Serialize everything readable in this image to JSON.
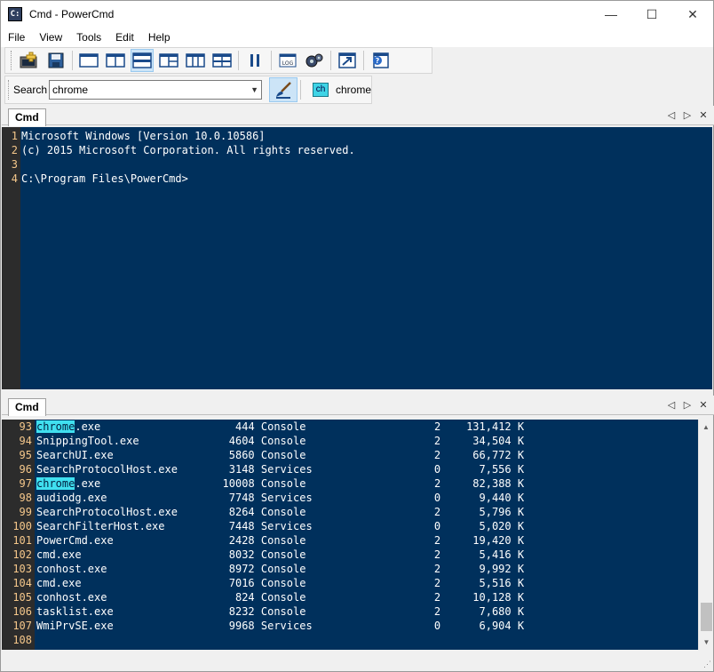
{
  "window": {
    "title": "Cmd - PowerCmd",
    "icon_text": "C:"
  },
  "window_controls": {
    "minimize": "—",
    "maximize": "☐",
    "close": "✕"
  },
  "menu": [
    "File",
    "View",
    "Tools",
    "Edit",
    "Help"
  ],
  "toolbar": {
    "buttons": [
      "new-console",
      "save",
      "layout-single",
      "layout-two-columns",
      "layout-two-rows",
      "layout-three-left",
      "layout-three-columns",
      "layout-four-grid",
      "pause",
      "log-bug",
      "settings-gears",
      "open-external",
      "help"
    ],
    "active_button": "layout-two-rows"
  },
  "search": {
    "label": "Search",
    "value": "chrome",
    "badge": "ch",
    "term": "chrome"
  },
  "pane_top": {
    "tab_label": "Cmd",
    "line_numbers": [
      "1",
      "2",
      "3",
      "4"
    ],
    "lines": [
      "Microsoft Windows [Version 10.0.10586]",
      "(c) 2015 Microsoft Corporation. All rights reserved.",
      "",
      "C:\\Program Files\\PowerCmd>"
    ]
  },
  "pane_bottom": {
    "tab_label": "Cmd",
    "rows": [
      {
        "n": "93",
        "name": "chrome.exe",
        "pid": "444",
        "session": "Console",
        "num": "2",
        "mem": "131,412 K"
      },
      {
        "n": "94",
        "name": "SnippingTool.exe",
        "pid": "4604",
        "session": "Console",
        "num": "2",
        "mem": "34,504 K"
      },
      {
        "n": "95",
        "name": "SearchUI.exe",
        "pid": "5860",
        "session": "Console",
        "num": "2",
        "mem": "66,772 K"
      },
      {
        "n": "96",
        "name": "SearchProtocolHost.exe",
        "pid": "3148",
        "session": "Services",
        "num": "0",
        "mem": "7,556 K"
      },
      {
        "n": "97",
        "name": "chrome.exe",
        "pid": "10008",
        "session": "Console",
        "num": "2",
        "mem": "82,388 K"
      },
      {
        "n": "98",
        "name": "audiodg.exe",
        "pid": "7748",
        "session": "Services",
        "num": "0",
        "mem": "9,440 K"
      },
      {
        "n": "99",
        "name": "SearchProtocolHost.exe",
        "pid": "8264",
        "session": "Console",
        "num": "2",
        "mem": "5,796 K"
      },
      {
        "n": "100",
        "name": "SearchFilterHost.exe",
        "pid": "7448",
        "session": "Services",
        "num": "0",
        "mem": "5,020 K"
      },
      {
        "n": "101",
        "name": "PowerCmd.exe",
        "pid": "2428",
        "session": "Console",
        "num": "2",
        "mem": "19,420 K"
      },
      {
        "n": "102",
        "name": "cmd.exe",
        "pid": "8032",
        "session": "Console",
        "num": "2",
        "mem": "5,416 K"
      },
      {
        "n": "103",
        "name": "conhost.exe",
        "pid": "8972",
        "session": "Console",
        "num": "2",
        "mem": "9,992 K"
      },
      {
        "n": "104",
        "name": "cmd.exe",
        "pid": "7016",
        "session": "Console",
        "num": "2",
        "mem": "5,516 K"
      },
      {
        "n": "105",
        "name": "conhost.exe",
        "pid": "824",
        "session": "Console",
        "num": "2",
        "mem": "10,128 K"
      },
      {
        "n": "106",
        "name": "tasklist.exe",
        "pid": "8232",
        "session": "Console",
        "num": "2",
        "mem": "7,680 K"
      },
      {
        "n": "107",
        "name": "WmiPrvSE.exe",
        "pid": "9968",
        "session": "Services",
        "num": "0",
        "mem": "6,904 K"
      },
      {
        "n": "108",
        "name": "",
        "pid": "",
        "session": "",
        "num": "",
        "mem": ""
      }
    ]
  },
  "colors": {
    "console_bg": "#00305c",
    "console_fg": "#ffffff",
    "gutter_bg": "#2c2c2c",
    "gutter_fg": "#f5c78a",
    "match_bg": "#40e0f0"
  }
}
